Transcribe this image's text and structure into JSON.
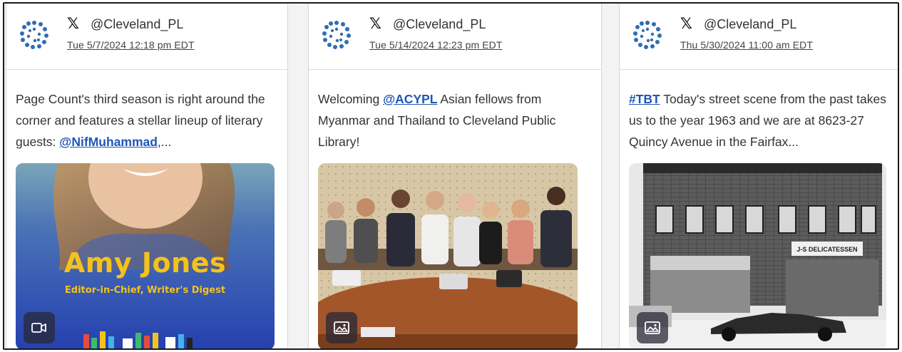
{
  "posts": [
    {
      "platform_icon": "x-logo-icon",
      "logo_glyph": "𝕏",
      "handle": "@Cleveland_PL",
      "timestamp": "Tue 5/7/2024 12:18 pm EDT",
      "text_before": "Page Count's third season is right around the corner and features a stellar lineup of literary guests: ",
      "mention": "@NifMuhammad",
      "text_after": ",...",
      "media_type": "video",
      "media_title": "Amy Jones",
      "media_subtitle": "Editor-in-Chief, Writer's Digest",
      "media_badge_icon": "video-camera-icon"
    },
    {
      "platform_icon": "x-logo-icon",
      "logo_glyph": "𝕏",
      "handle": "@Cleveland_PL",
      "timestamp": "Tue 5/14/2024 12:23 pm EDT",
      "text_before": "Welcoming ",
      "mention": "@ACYPL",
      "text_after": " Asian fellows from Myanmar and Thailand to Cleveland Public Library!",
      "media_type": "image",
      "media_badge_icon": "image-icon"
    },
    {
      "platform_icon": "x-logo-icon",
      "logo_glyph": "𝕏",
      "handle": "@Cleveland_PL",
      "timestamp": "Thu 5/30/2024 11:00 am EDT",
      "hashtag": "#TBT",
      "text_after": " Today's street scene from the past takes us to the year 1963 and we are at 8623-27 Quincy Avenue in the Fairfax...",
      "media_type": "image",
      "storefront_sign": "J-S DELICATESSEN",
      "media_badge_icon": "image-icon"
    }
  ],
  "colors": {
    "link": "#1f56b5",
    "avatar": "#2e6db3",
    "name_yellow": "#f5c21b"
  }
}
